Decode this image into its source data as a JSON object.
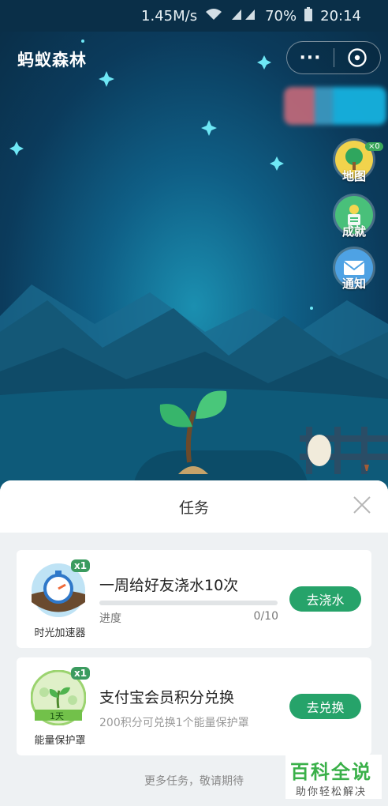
{
  "status_bar": {
    "speed": "1.45M/s",
    "battery": "70%",
    "time": "20:14"
  },
  "header": {
    "title": "蚂蚁森林",
    "more": "···"
  },
  "side_menu": [
    {
      "label": "地图",
      "badge": "×0"
    },
    {
      "label": "成就"
    },
    {
      "label": "通知"
    }
  ],
  "panel": {
    "title": "任务"
  },
  "tasks": [
    {
      "icon_caption": "时光加速器",
      "count": "x1",
      "title": "一周给好友浇水10次",
      "progress_label": "进度",
      "progress_text": "0/10",
      "progress_fraction": 0,
      "button": "去浇水"
    },
    {
      "icon_caption": "能量保护罩",
      "count": "x1",
      "icon_tag": "1天",
      "title": "支付宝会员积分兑换",
      "subtitle": "200积分可兑换1个能量保护罩",
      "button": "去兑换"
    }
  ],
  "footer_note": "更多任务，敬请期待",
  "watermark": {
    "main": "百科全说",
    "sub": "助你轻松解决"
  },
  "colors": {
    "accent": "#26a36a",
    "sky": "#0b3b5c",
    "badge": "#3b9b5f"
  }
}
